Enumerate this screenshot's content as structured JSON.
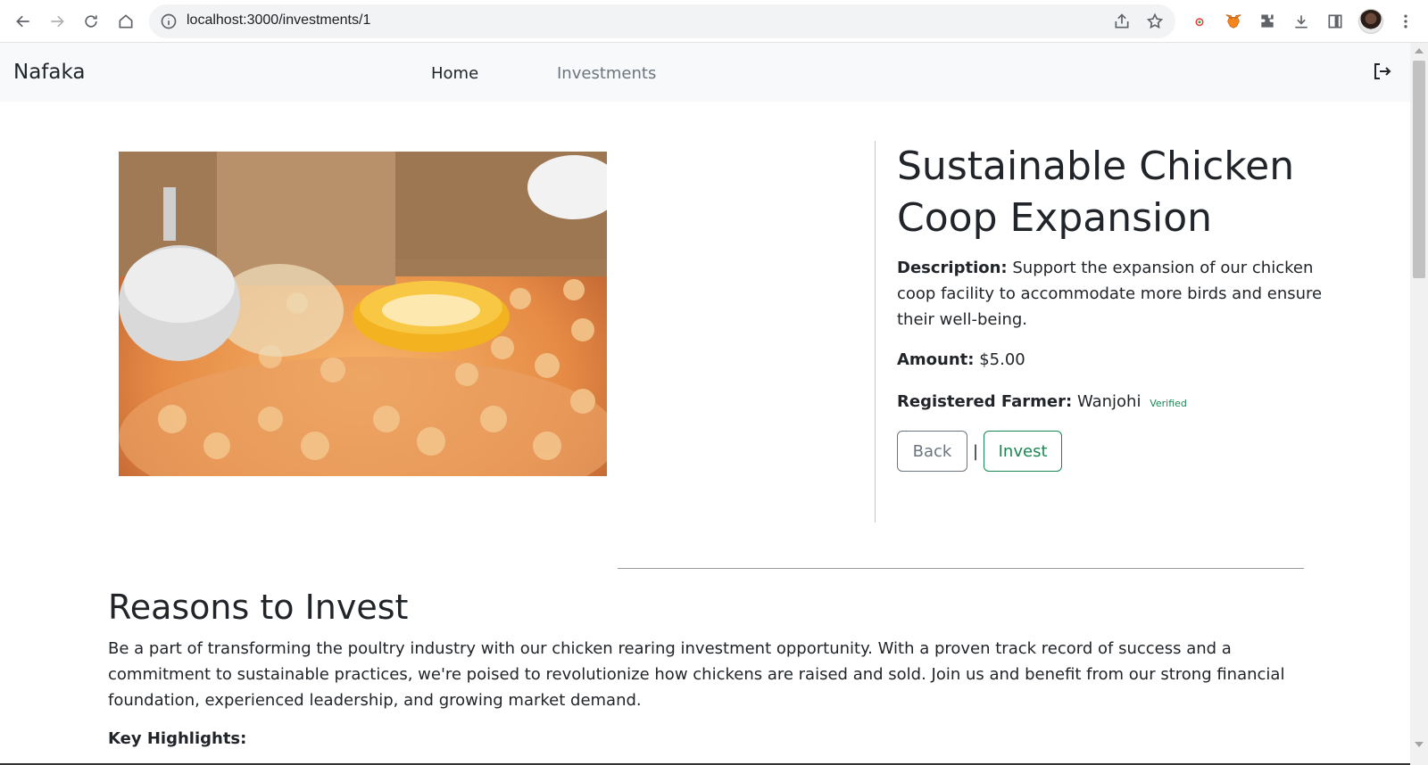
{
  "browser": {
    "url": "localhost:3000/investments/1"
  },
  "navbar": {
    "brand": "Nafaka",
    "links": [
      {
        "label": "Home"
      },
      {
        "label": "Investments"
      }
    ]
  },
  "investment": {
    "title": "Sustainable Chicken Coop Expansion",
    "description_label": "Description:",
    "description": "Support the expansion of our chicken coop facility to accommodate more birds and ensure their well-being.",
    "amount_label": "Amount:",
    "amount": "$5.00",
    "farmer_label": "Registered Farmer:",
    "farmer": "Wanjohi",
    "verified": "Verified",
    "back_label": "Back",
    "separator": "|",
    "invest_label": "Invest"
  },
  "reasons": {
    "title": "Reasons to Invest",
    "text": "Be a part of transforming the poultry industry with our chicken rearing investment opportunity. With a proven track record of success and a commitment to sustainable practices, we're poised to revolutionize how chickens are raised and sold. Join us and benefit from our strong financial foundation, experienced leadership, and growing market demand.",
    "highlights_label": "Key Highlights:"
  },
  "colors": {
    "success": "#198754",
    "secondary": "#6c757d",
    "navbar_bg": "#f8f9fa"
  }
}
